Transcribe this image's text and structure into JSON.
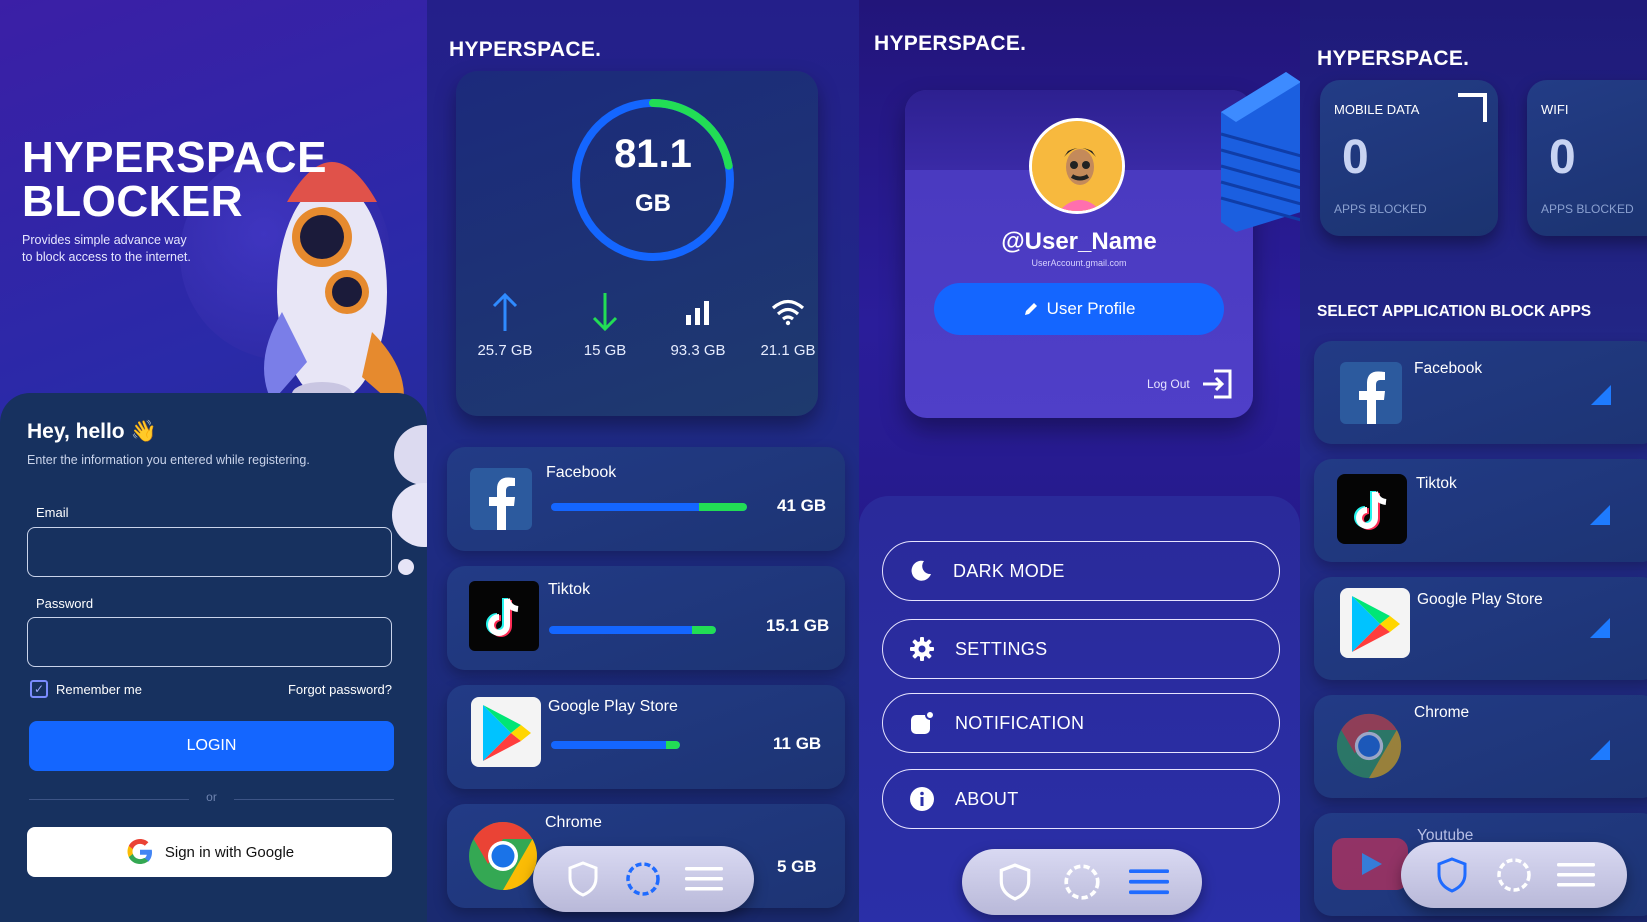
{
  "login": {
    "hero_line1": "HYPERSPACE",
    "hero_line2": "BLOCKER",
    "hero_subtitle": "Provides simple advance way to block access to the internet.",
    "greeting": "Hey, hello 👋",
    "greeting_sub": "Enter the information you entered while registering.",
    "email_label": "Email",
    "email_value": "",
    "password_label": "Password",
    "password_value": "",
    "remember_label": "Remember me",
    "remember_checked": true,
    "forgot_label": "Forgot password?",
    "login_label": "LOGIN",
    "or_label": "or",
    "google_label": "Sign in with Google"
  },
  "usage": {
    "brand": "HYPERSPACE.",
    "total_value": "81.1",
    "total_unit": "GB",
    "ring_progress": 0.22,
    "stats": [
      {
        "icon": "upload-arrow-icon",
        "value": "25.7 GB"
      },
      {
        "icon": "download-arrow-icon",
        "value": "15 GB"
      },
      {
        "icon": "signal-bars-icon",
        "value": "93.3 GB"
      },
      {
        "icon": "wifi-icon",
        "value": "21.1 GB"
      }
    ],
    "apps": [
      {
        "name": "Facebook",
        "usage": "41  GB",
        "fraction": 1.0
      },
      {
        "name": "Tiktok",
        "usage": "15.1  GB",
        "fraction": 0.85
      },
      {
        "name": "Google Play Store",
        "usage": "11  GB",
        "fraction": 0.66
      },
      {
        "name": "Chrome",
        "usage": "5 GB",
        "fraction": 0.3
      }
    ]
  },
  "profile": {
    "brand": "HYPERSPACE.",
    "username": "@User_Name",
    "email": "UserAccount.gmail.com",
    "profile_button": "User Profile",
    "logout_label": "Log Out",
    "menu": [
      {
        "label": "DARK MODE",
        "icon": "moon-icon"
      },
      {
        "label": "SETTINGS",
        "icon": "gear-icon"
      },
      {
        "label": "NOTIFICATION",
        "icon": "notification-icon"
      },
      {
        "label": "ABOUT",
        "icon": "info-icon"
      }
    ]
  },
  "block": {
    "brand": "HYPERSPACE.",
    "mobile_label": "MOBILE DATA",
    "mobile_value": "0",
    "mobile_sub": "APPS BLOCKED",
    "wifi_label": "WIFI",
    "wifi_value": "0",
    "wifi_sub": "APPS BLOCKED",
    "section_title": "SELECT APPLICATION BLOCK APPS",
    "apps": [
      "Facebook",
      "Tiktok",
      "Google Play Store",
      "Chrome",
      "Youtube"
    ]
  },
  "nav": {
    "items": [
      "shield-icon",
      "loading-icon",
      "menu-icon"
    ]
  },
  "colors": {
    "accent": "#1466ff",
    "green": "#22dd55",
    "bg_deep": "#1a1a5e"
  }
}
